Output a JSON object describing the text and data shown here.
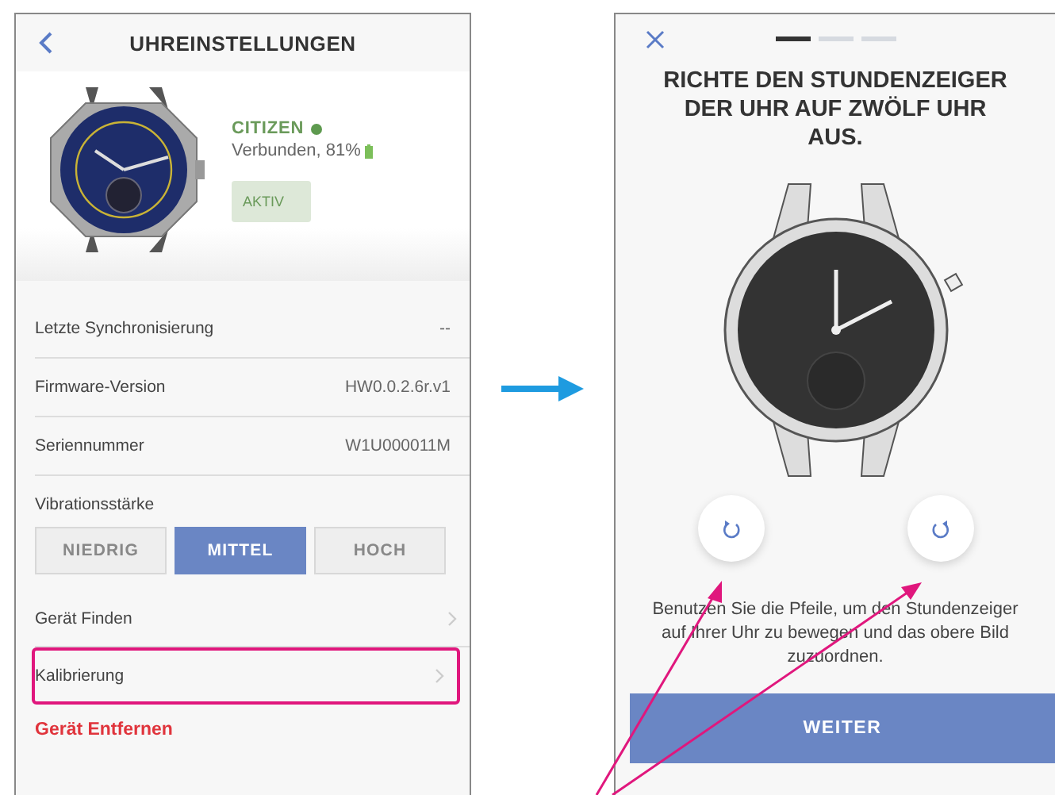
{
  "settings_screen": {
    "title": "UHREINSTELLUNGEN",
    "device": {
      "brand": "CITIZEN",
      "connected": true,
      "status": "Verbunden, 81%",
      "badge": "AKTIV"
    },
    "info_rows": [
      {
        "label": "Letzte Synchronisierung",
        "value": "--"
      },
      {
        "label": "Firmware-Version",
        "value": "HW0.0.2.6r.v1"
      },
      {
        "label": "Seriennummer",
        "value": "W1U000011M"
      }
    ],
    "vibration": {
      "label": "Vibrationsstärke",
      "options": [
        {
          "label": "NIEDRIG",
          "selected": false
        },
        {
          "label": "MITTEL",
          "selected": true
        },
        {
          "label": "HOCH",
          "selected": false
        }
      ]
    },
    "menu_items": [
      {
        "label": "Gerät Finden",
        "highlighted": false
      },
      {
        "label": "Kalibrierung",
        "highlighted": true
      }
    ],
    "remove_label": "Gerät Entfernen"
  },
  "calibration_screen": {
    "steps": [
      {
        "selected": true
      },
      {
        "selected": false
      },
      {
        "selected": false
      }
    ],
    "title": "RICHTE DEN STUNDENZEIGER DER UHR AUF ZWÖLF UHR AUS.",
    "instruction": "Benutzen Sie die Pfeile, um den Stundenzeiger auf Ihrer Uhr zu bewegen und das obere Bild zuzuordnen.",
    "button": "WEITER"
  }
}
